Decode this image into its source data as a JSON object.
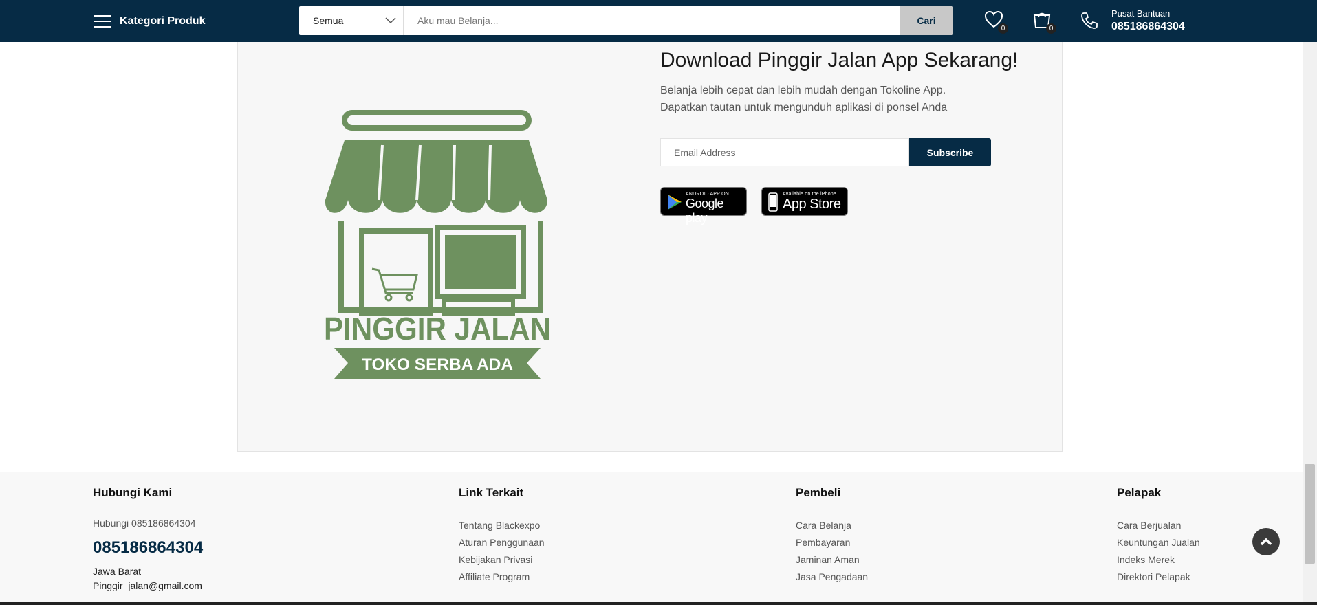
{
  "header": {
    "category_label": "Kategori Produk",
    "search_category": "Semua",
    "search_placeholder": "Aku mau Belanja...",
    "search_button": "Cari",
    "wishlist_count": "0",
    "cart_count": "0",
    "help_title": "Pusat Bantuan",
    "help_phone": "085186864304"
  },
  "promo": {
    "logo_title": "PINGGIR JALAN",
    "logo_subtitle": "TOKO SERBA ADA",
    "heading": "Download Pinggir Jalan App Sekarang!",
    "subtext_line1": "Belanja lebih cepat dan lebih mudah dengan Tokoline App.",
    "subtext_line2": "Dapatkan tautan untuk mengunduh aplikasi di ponsel Anda",
    "email_placeholder": "Email Address",
    "subscribe_label": "Subscribe",
    "google_play_small": "ANDROID APP ON",
    "google_play_big": "Google play",
    "app_store_small": "Available on the iPhone",
    "app_store_big": "App Store"
  },
  "footer": {
    "contact": {
      "heading": "Hubungi Kami",
      "note": "Hubungi 085186864304",
      "phone": "085186864304",
      "region": "Jawa Barat",
      "email": "Pinggir_jalan@gmail.com"
    },
    "columns": [
      {
        "heading": "Link Terkait",
        "links": [
          "Tentang Blackexpo",
          "Aturan Penggunaan",
          "Kebijakan Privasi",
          "Affiliate Program"
        ]
      },
      {
        "heading": "Pembeli",
        "links": [
          "Cara Belanja",
          "Pembayaran",
          "Jaminan Aman",
          "Jasa Pengadaan"
        ]
      },
      {
        "heading": "Pelapak",
        "links": [
          "Cara Berjualan",
          "Keuntungan Jualan",
          "Indeks Merek",
          "Direktori Pelapak"
        ]
      }
    ]
  },
  "colors": {
    "navy": "#062b45",
    "logo_green": "#6e915f"
  },
  "icons": [
    "hamburger-icon",
    "chevron-down-icon",
    "heart-icon",
    "shopping-bag-icon",
    "phone-icon",
    "chevron-up-icon"
  ]
}
